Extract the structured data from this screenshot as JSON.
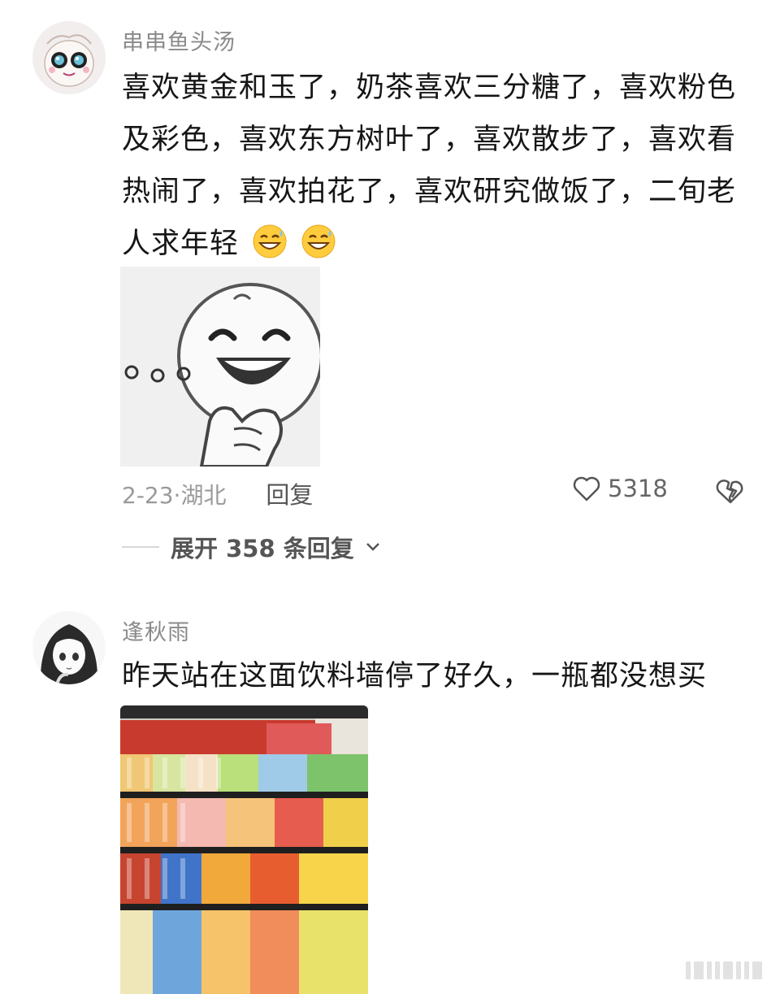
{
  "comments": [
    {
      "username": "串串鱼头汤",
      "text_lines": [
        "喜欢黄金和玉了，奶茶喜欢三分糖了，喜欢粉色",
        "及彩色，喜欢东方树叶了，喜欢散步了，喜欢看",
        "热闹了，喜欢拍花了，喜欢研究做饭了，二旬老",
        "人求年轻"
      ],
      "emoji": [
        "grinning-sweat-emoji",
        "grinning-sweat-emoji"
      ],
      "image": "thinking-smile-sticker",
      "date_location": "2-23·湖北",
      "reply_label": "回复",
      "like_count": "5318",
      "expand_label": "展开 358 条回复"
    },
    {
      "username": "逢秋雨",
      "text_lines": [
        "昨天站在这面饮料墙停了好久，一瓶都没想买"
      ],
      "image": "beverage-shelf-photo"
    }
  ],
  "colors": {
    "username": "#8a8a8a",
    "text": "#161616",
    "meta": "#9a9a9a"
  }
}
